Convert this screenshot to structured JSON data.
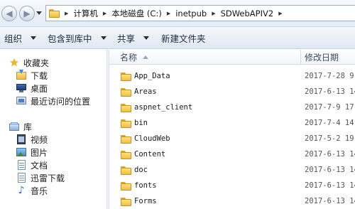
{
  "address_bar": {
    "crumbs": [
      "计算机",
      "本地磁盘 (C:)",
      "inetpub",
      "SDWebAPIV2"
    ]
  },
  "toolbar": {
    "organize": "组织",
    "include_in_library": "包含到库中",
    "share": "共享",
    "new_folder": "新建文件夹"
  },
  "nav": {
    "favorites": {
      "label": "收藏夹",
      "items": [
        {
          "label": "下载",
          "icon": "download-folder-icon"
        },
        {
          "label": "桌面",
          "icon": "desktop-icon"
        },
        {
          "label": "最近访问的位置",
          "icon": "recent-places-icon"
        }
      ]
    },
    "libraries": {
      "label": "库",
      "items": [
        {
          "label": "视频",
          "icon": "video-icon"
        },
        {
          "label": "图片",
          "icon": "pictures-icon"
        },
        {
          "label": "文档",
          "icon": "documents-icon"
        },
        {
          "label": "迅雷下载",
          "icon": "thunder-download-icon"
        },
        {
          "label": "音乐",
          "icon": "music-icon"
        }
      ]
    }
  },
  "file_list": {
    "columns": {
      "name": "名称",
      "date": "修改日期"
    },
    "rows": [
      {
        "name": "App_Data",
        "date": "2017-7-28 9:"
      },
      {
        "name": "Areas",
        "date": "2017-6-13 14"
      },
      {
        "name": "aspnet_client",
        "date": "2017-7-9 17:"
      },
      {
        "name": "bin",
        "date": "2017-7-4 14:"
      },
      {
        "name": "CloudWeb",
        "date": "2017-5-2 19:"
      },
      {
        "name": "Content",
        "date": "2017-6-13 14"
      },
      {
        "name": "doc",
        "date": "2017-6-13 14"
      },
      {
        "name": "fonts",
        "date": "2017-6-13 14"
      },
      {
        "name": "Forms",
        "date": "2017-6-13 14"
      }
    ]
  },
  "colors": {
    "toolbar_gradient_top": "#f5f8fc",
    "toolbar_gradient_bottom": "#dfe8f3",
    "folder_yellow": "#f0bf3f"
  }
}
